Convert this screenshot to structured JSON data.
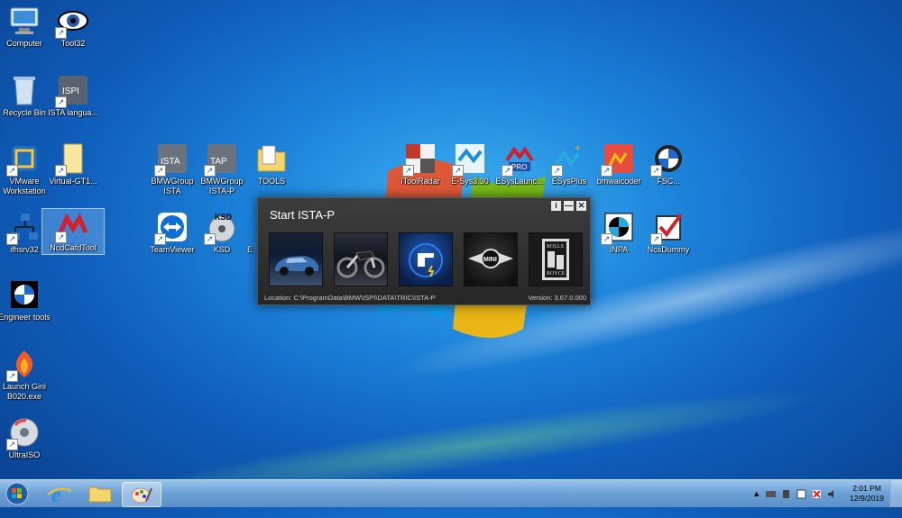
{
  "desktop": {
    "icons": [
      {
        "label": "Computer"
      },
      {
        "label": "Tool32"
      },
      {
        "label": "Recycle Bin"
      },
      {
        "label": "ISTA langua..."
      },
      {
        "label": "VMware Workstation"
      },
      {
        "label": "Virtual-GT1..."
      },
      {
        "label": "BMWGroup ISTA"
      },
      {
        "label": "BMWGroup ISTA-P"
      },
      {
        "label": "TOOLS"
      },
      {
        "label": "IToolRadar"
      },
      {
        "label": "E-Sys3.30"
      },
      {
        "label": "ESysLaunc..."
      },
      {
        "label": "ESysPlus"
      },
      {
        "label": "bmwaicoder"
      },
      {
        "label": "FSC..."
      },
      {
        "label": "ifhsrv32"
      },
      {
        "label": "NcdCafdTool"
      },
      {
        "label": "TeamViewer"
      },
      {
        "label": "KSD"
      },
      {
        "label": "E"
      },
      {
        "label": "INPA"
      },
      {
        "label": "NcsDummy"
      },
      {
        "label": "Engineer tools"
      },
      {
        "label": "Launch Gini B020.exe"
      },
      {
        "label": "UltraISO"
      }
    ]
  },
  "dialog": {
    "title": "Start ISTA-P",
    "buttons": {
      "info": "i",
      "minimize": "—",
      "close": "✕"
    },
    "tiles": [
      "BMW car",
      "BMW motorrad",
      "ISTA-P",
      "MINI",
      "Rolls-Royce"
    ],
    "location": "Location:  C:\\ProgramData\\BMW\\ISPI\\DATA\\TRIC\\ISTA-P",
    "version": "Version: 3.67.0.000"
  },
  "taskbar": {
    "clock_time": "2:01 PM",
    "clock_date": "12/9/2019"
  }
}
